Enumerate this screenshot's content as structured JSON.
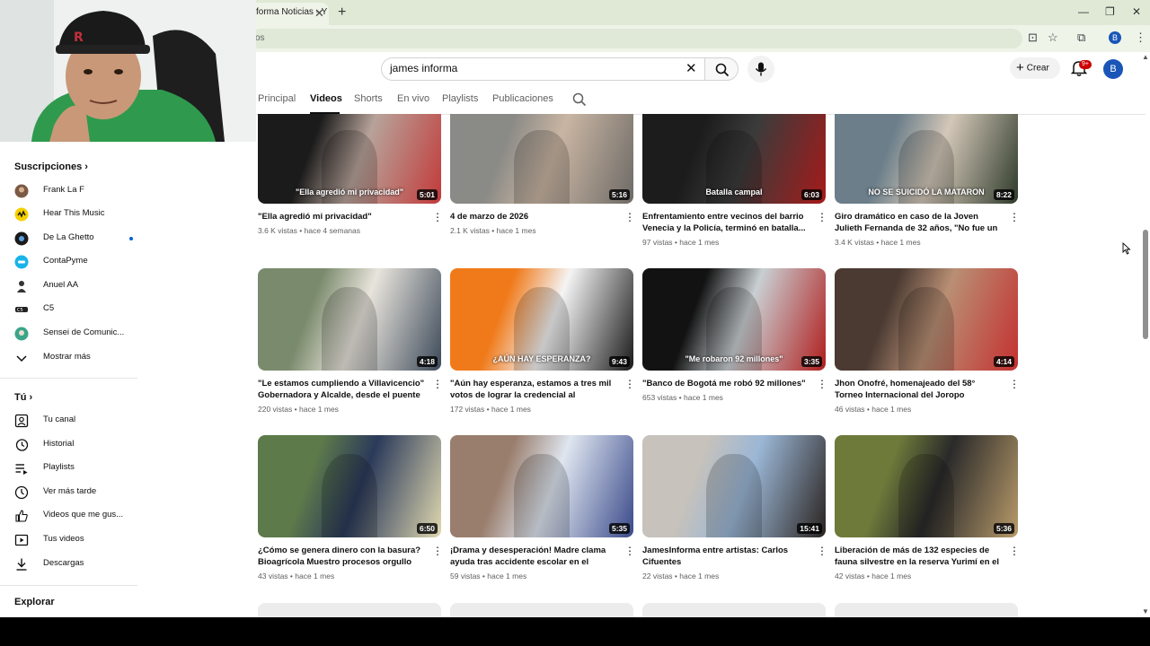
{
  "browser": {
    "tab_title": "forma Noticias - Y",
    "address": "os",
    "profile_initial": "B"
  },
  "header": {
    "search_value": "james informa",
    "create_label": "Crear",
    "notification_badge": "9+",
    "avatar_initial": "B"
  },
  "channel_tabs": [
    {
      "label": "Principal"
    },
    {
      "label": "Videos",
      "active": true
    },
    {
      "label": "Shorts"
    },
    {
      "label": "En vivo"
    },
    {
      "label": "Playlists"
    },
    {
      "label": "Publicaciones"
    }
  ],
  "sidebar": {
    "subscriptions_heading": "Suscripciones",
    "channels": [
      {
        "label": "Frank La F",
        "icon": "channel-avatar"
      },
      {
        "label": "Hear This Music",
        "icon": "channel-avatar"
      },
      {
        "label": "De La Ghetto",
        "icon": "channel-avatar",
        "new_content": true
      },
      {
        "label": "ContaPyme",
        "icon": "channel-avatar"
      },
      {
        "label": "Anuel AA",
        "icon": "channel-avatar"
      },
      {
        "label": "C5",
        "icon": "channel-avatar"
      },
      {
        "label": "Sensei de Comunic...",
        "icon": "channel-avatar"
      }
    ],
    "show_more_label": "Mostrar más",
    "you_heading": "Tú",
    "you_items": [
      {
        "label": "Tu canal",
        "icon": "channel-icon"
      },
      {
        "label": "Historial",
        "icon": "history-icon"
      },
      {
        "label": "Playlists",
        "icon": "playlists-icon"
      },
      {
        "label": "Ver más tarde",
        "icon": "clock-icon"
      },
      {
        "label": "Videos que me gus...",
        "icon": "thumbs-up-icon"
      },
      {
        "label": "Tus videos",
        "icon": "video-icon"
      },
      {
        "label": "Descargas",
        "icon": "download-icon"
      }
    ],
    "explore_heading": "Explorar"
  },
  "videos": [
    {
      "title": "\"Ella agredió mi privacidad\"",
      "views": "3.6 K vistas",
      "age": "hace 4 semanas",
      "duration": "5:01",
      "caption": "\"Ella agredió mi privacidad\"",
      "colors": [
        "#1b1b1b",
        "#b7a39a",
        "#c23a3a"
      ]
    },
    {
      "title": "4 de marzo de 2026",
      "views": "2.1 K vistas",
      "age": "hace 1 mes",
      "duration": "5:16",
      "caption": "",
      "colors": [
        "#8a8a86",
        "#c9b5a3",
        "#6d6a66"
      ]
    },
    {
      "title": "Enfrentamiento entre vecinos del barrio Venecia y la Policía, terminó en batalla...",
      "views": "97 vistas",
      "age": "hace 1 mes",
      "duration": "6:03",
      "caption": "Batalla campal",
      "colors": [
        "#1c1c1c",
        "#3b3b3b",
        "#a61a1a"
      ]
    },
    {
      "title": "Giro dramático en caso de la Joven Julieth Fernanda de 32 años, \"No fue un suicidio,...",
      "views": "3.4 K vistas",
      "age": "hace 1 mes",
      "duration": "8:22",
      "caption": "NO SE SUICIDÓ LA MATARON",
      "colors": [
        "#6b7e8a",
        "#d3c7b8",
        "#2e3a2a"
      ]
    },
    {
      "title": "\"Le estamos cumpliendo a Villavicencio\" Gobernadora y Alcalde, desde el puente Vill...",
      "views": "220 vistas",
      "age": "hace 1 mes",
      "duration": "4:18",
      "caption": "",
      "colors": [
        "#7a8a6c",
        "#e8e4dc",
        "#3d4a5a"
      ]
    },
    {
      "title": "\"Aún hay esperanza, estamos a tres mil votos de lograr la credencial al Senado\"...",
      "views": "172 vistas",
      "age": "hace 1 mes",
      "duration": "9:43",
      "caption": "¿AÚN HAY ESPERANZA?",
      "colors": [
        "#f07a1a",
        "#f4f4f4",
        "#1a1a1a"
      ]
    },
    {
      "title": "\"Banco de Bogotá me robó 92 millones\"",
      "views": "653 vistas",
      "age": "hace 1 mes",
      "duration": "3:35",
      "caption": "\"Me robaron 92 millones\"",
      "colors": [
        "#121212",
        "#c9cfd2",
        "#b01e1e"
      ]
    },
    {
      "title": "Jhon Onofré, homenajeado del 58° Torneo Internacional del Joropo",
      "views": "46 vistas",
      "age": "hace 1 mes",
      "duration": "4:14",
      "caption": "",
      "colors": [
        "#4a3a32",
        "#b98f74",
        "#c43030"
      ]
    },
    {
      "title": "¿Cómo se genera dinero con la basura? Bioagrícola Muestro procesos orgullo para ...",
      "views": "43 vistas",
      "age": "hace 1 mes",
      "duration": "6:50",
      "caption": "",
      "colors": [
        "#5d7a4a",
        "#2b3a5a",
        "#e0d8b0"
      ]
    },
    {
      "title": "¡Drama y desesperación! Madre clama ayuda tras accidente escolar en el colegio de...",
      "views": "59 vistas",
      "age": "hace 1 mes",
      "duration": "5:35",
      "caption": "",
      "colors": [
        "#9a7e6d",
        "#dfe6f0",
        "#3a4a8a"
      ]
    },
    {
      "title": "JamesInforma entre artistas: Carlos Cifuentes",
      "views": "22 vistas",
      "age": "hace 1 mes",
      "duration": "15:41",
      "caption": "",
      "colors": [
        "#c7c2bb",
        "#9bb7d6",
        "#2a2320"
      ]
    },
    {
      "title": "Liberación de más de 132 especies de fauna silvestre en la reserva Yurimí en el Meta.",
      "views": "42 vistas",
      "age": "hace 1 mes",
      "duration": "5:36",
      "caption": "",
      "colors": [
        "#6e7a3a",
        "#2a2a2a",
        "#b89a6a"
      ]
    }
  ]
}
